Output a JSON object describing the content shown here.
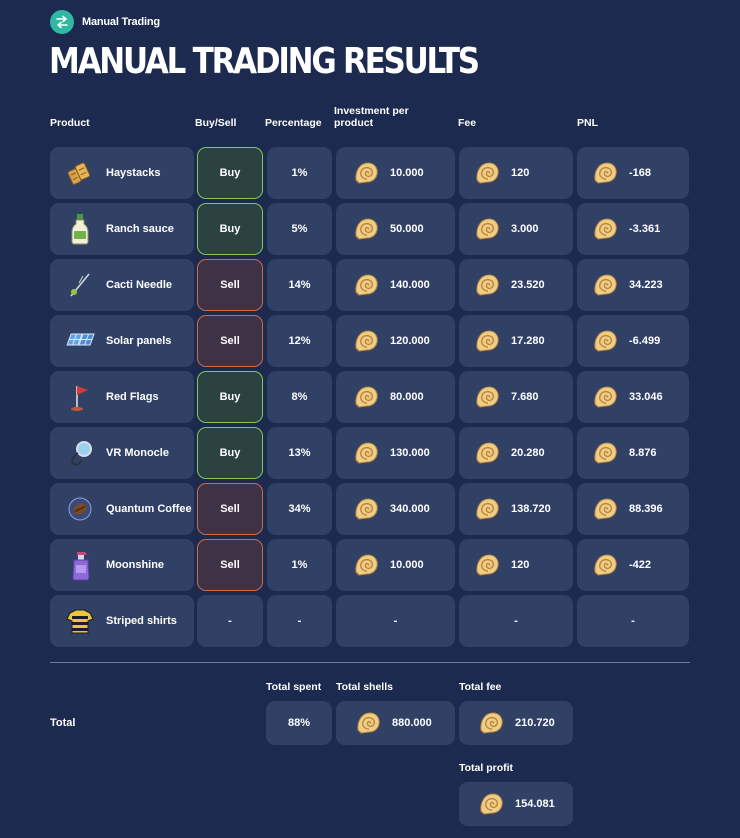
{
  "app": {
    "title": "Manual Trading",
    "icon": "trade-arrows-icon"
  },
  "page_title": "MANUAL TRADING RESULTS",
  "columns": {
    "product": "Product",
    "buy_sell": "Buy/Sell",
    "percentage": "Percentage",
    "investment": "Investment per product",
    "fee": "Fee",
    "pnl": "PNL"
  },
  "currency_icon": "seashell-icon",
  "rows": [
    {
      "product": "Haystacks",
      "icon": "haystack-icon",
      "side": "Buy",
      "percentage": "1%",
      "investment": "10.000",
      "fee": "120",
      "pnl": "-168"
    },
    {
      "product": "Ranch sauce",
      "icon": "sauce-bottle-icon",
      "side": "Buy",
      "percentage": "5%",
      "investment": "50.000",
      "fee": "3.000",
      "pnl": "-3.361"
    },
    {
      "product": "Cacti Needle",
      "icon": "needle-icon",
      "side": "Sell",
      "percentage": "14%",
      "investment": "140.000",
      "fee": "23.520",
      "pnl": "34.223"
    },
    {
      "product": "Solar panels",
      "icon": "solar-panel-icon",
      "side": "Sell",
      "percentage": "12%",
      "investment": "120.000",
      "fee": "17.280",
      "pnl": "-6.499"
    },
    {
      "product": "Red Flags",
      "icon": "red-flag-icon",
      "side": "Buy",
      "percentage": "8%",
      "investment": "80.000",
      "fee": "7.680",
      "pnl": "33.046"
    },
    {
      "product": "VR Monocle",
      "icon": "monocle-icon",
      "side": "Buy",
      "percentage": "13%",
      "investment": "130.000",
      "fee": "20.280",
      "pnl": "8.876"
    },
    {
      "product": "Quantum Coffee",
      "icon": "coffee-bean-icon",
      "side": "Sell",
      "percentage": "34%",
      "investment": "340.000",
      "fee": "138.720",
      "pnl": "88.396"
    },
    {
      "product": "Moonshine",
      "icon": "spray-bottle-icon",
      "side": "Sell",
      "percentage": "1%",
      "investment": "10.000",
      "fee": "120",
      "pnl": "-422"
    },
    {
      "product": "Striped shirts",
      "icon": "striped-shirt-icon",
      "side": "-",
      "percentage": "-",
      "investment": "-",
      "fee": "-",
      "pnl": "-"
    }
  ],
  "totals": {
    "label": "Total",
    "spent_label": "Total spent",
    "spent": "88%",
    "shells_label": "Total shells",
    "shells": "880.000",
    "fee_label": "Total fee",
    "fee": "210.720",
    "profit_label": "Total profit",
    "profit": "154.081"
  },
  "colors": {
    "background": "#1b2a4e",
    "cell": "#314166",
    "buy_border": "#86c55c",
    "sell_border": "#d16a47",
    "app_icon": "#2fb8a4"
  }
}
